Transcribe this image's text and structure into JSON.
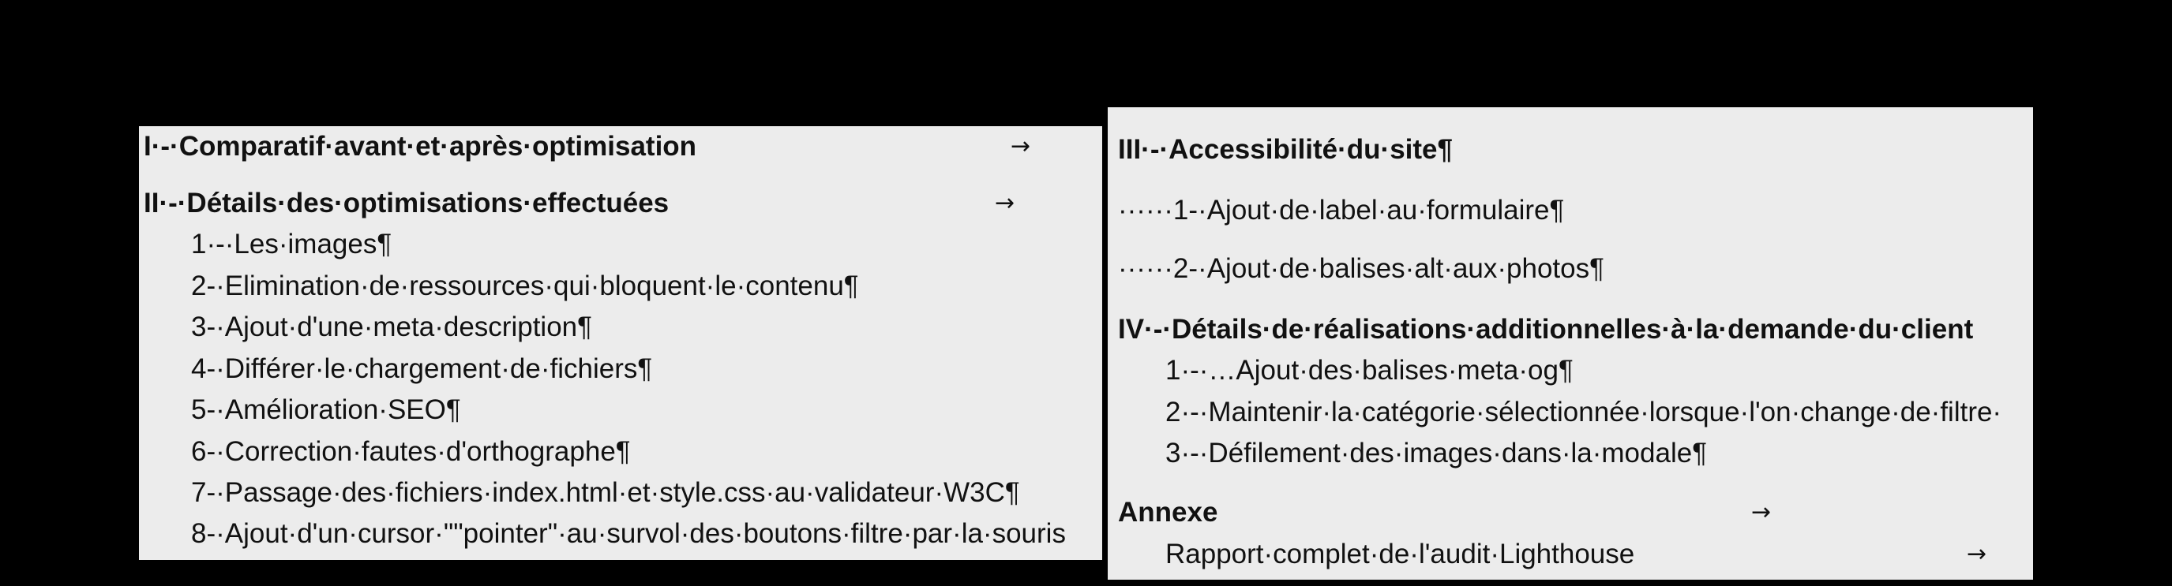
{
  "left_column": {
    "heading_1": {
      "text": "I·-·Comparatif·avant·et·après·optimisation",
      "arrow": "→"
    },
    "heading_2": {
      "text": "II·-·Détails·des·optimisations·effectuées",
      "arrow": "→"
    },
    "items": [
      "1·-·Les·images¶",
      "2-·Elimination·de·ressources·qui·bloquent·le·contenu¶",
      "3-·Ajout·d'une·meta·description¶",
      "4-·Différer·le·chargement·de·fichiers¶",
      "5-·Amélioration·SEO¶",
      "6-·Correction·fautes·d'orthographe¶",
      "7-·Passage·des·fichiers·index.html·et·style.css·au·validateur·W3C¶",
      "8-·Ajout·d'un·cursor·\"\"pointer\"·au·survol·des·boutons·filtre·par·la·souris"
    ]
  },
  "right_column": {
    "heading_3": {
      "text": "III·-·Accessibilité·du·site¶"
    },
    "section_3_items": [
      "······1-·Ajout·de·label·au·formulaire¶",
      "······2-·Ajout·de·balises·alt·aux·photos¶"
    ],
    "heading_4": {
      "text": "IV·-·Détails·de·réalisations·additionnelles·à·la·demande·du·client"
    },
    "section_4_items": [
      "1·-·…Ajout·des·balises·meta·og¶",
      "2·-·Maintenir·la·catégorie·sélectionnée·lorsque·l'on·change·de·filtre·",
      "3·-·Défilement·des·images·dans·la·modale¶"
    ],
    "annexe": {
      "text": "Annexe",
      "arrow": "→"
    },
    "annexe_item": {
      "text": "Rapport·complet·de·l'audit·Lighthouse",
      "arrow": "→"
    }
  }
}
